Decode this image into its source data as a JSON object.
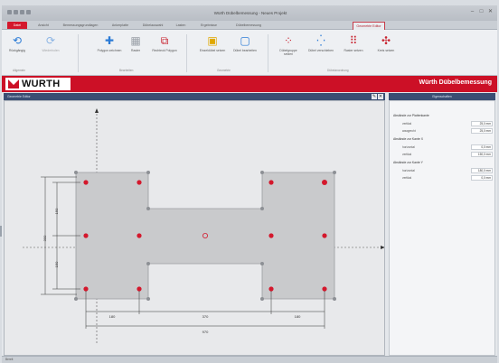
{
  "window": {
    "title": "Würth Dübelbemessung - Neues Projekt",
    "controls": [
      "–",
      "□",
      "✕"
    ]
  },
  "ribbon_tabs": [
    "Datei",
    "Ansicht",
    "Bemessungsgrundlagen",
    "Ankerplatte",
    "Dübelauswahl",
    "Lasten",
    "Ergebnisse",
    "Dübelbemessung",
    "Geometrie Editor"
  ],
  "ribbon": {
    "groups": [
      "Allgemein",
      "Bearbeiten",
      "Geometrie",
      "Dübelanordnung"
    ],
    "buttons": [
      {
        "label": "Rückgängig",
        "icon": "undo-icon"
      },
      {
        "label": "Wiederholen",
        "icon": "redo-icon"
      },
      {
        "label": "Polygon zeichnen",
        "icon": "add-point-icon"
      },
      {
        "label": "Raster",
        "icon": "grid-icon"
      },
      {
        "label": "Rechteck Polygon",
        "icon": "polygon-icon"
      },
      {
        "label": "Einzeldübel setzen",
        "icon": "single-anchor-icon"
      },
      {
        "label": "Dübel bearbeiten",
        "icon": "edit-anchor-icon"
      },
      {
        "label": "Dübelgruppe setzen",
        "icon": "anchor-group-icon"
      },
      {
        "label": "Dübel verschieben",
        "icon": "move-anchors-icon"
      },
      {
        "label": "Raster setzen",
        "icon": "anchor-grid-icon"
      },
      {
        "label": "Kreis setzen",
        "icon": "circle-anchors-icon"
      }
    ]
  },
  "brand": {
    "logo": "WURTH",
    "app_title": "Würth Dübelbemessung"
  },
  "canvas": {
    "title": "Geometrie Editor",
    "dimensions": {
      "left_total": "300",
      "left_upper": "150",
      "left_lower": "150",
      "bottom_left": "180",
      "bottom_middle": "370",
      "bottom_right": "180",
      "bottom_total": "970"
    }
  },
  "properties": {
    "title": "Eigenschaften",
    "sections": [
      {
        "title": "Abstände zur Plattenkante",
        "rows": [
          {
            "label": "vertikal",
            "value": "25,0 mm"
          },
          {
            "label": "waagrecht",
            "value": "25,0 mm"
          }
        ]
      },
      {
        "title": "Abstände zur Kante X",
        "rows": [
          {
            "label": "horizontal",
            "value": "0,0 mm"
          },
          {
            "label": "vertikal",
            "value": "150,0 mm"
          }
        ]
      },
      {
        "title": "Abstände zur Kante Y",
        "rows": [
          {
            "label": "horizontal",
            "value": "180,0 mm"
          },
          {
            "label": "vertikal",
            "value": "0,0 mm"
          }
        ]
      }
    ]
  },
  "status": "Bereit",
  "colors": {
    "brand_red": "#cc1026",
    "panel_header": "#3a4e73",
    "anchor_red": "#d4182c",
    "plate_gray": "#c9cacc"
  }
}
